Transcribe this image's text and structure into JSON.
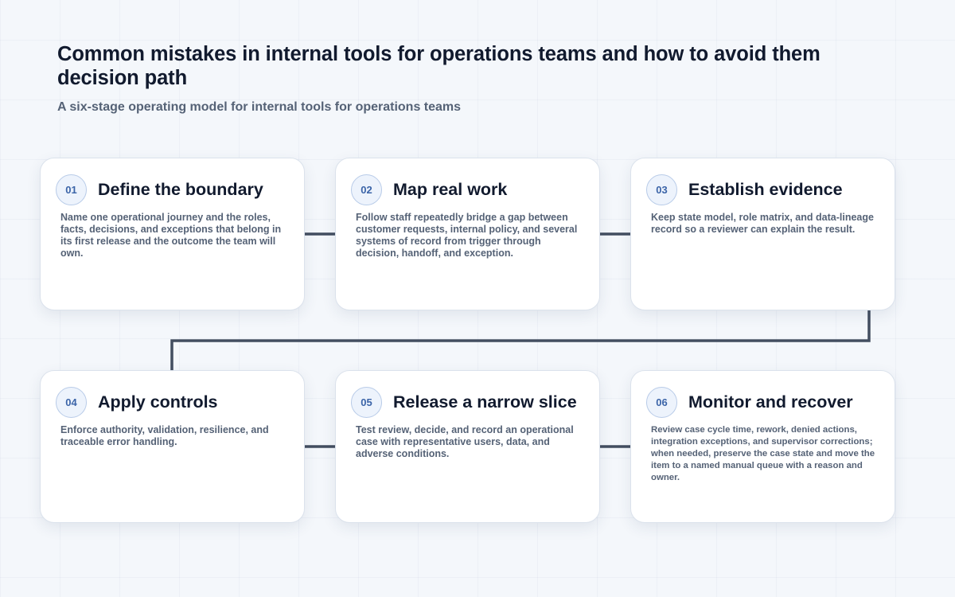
{
  "header": {
    "title": "Common mistakes in internal tools for operations teams and how to avoid them decision path",
    "subtitle": "A six-stage operating model for internal tools for operations teams"
  },
  "stages": [
    {
      "number": "01",
      "title": "Define the boundary",
      "description": "Name one operational journey and the roles, facts, decisions, and exceptions that belong in its first release and the outcome the team will own."
    },
    {
      "number": "02",
      "title": "Map real work",
      "description": "Follow staff repeatedly bridge a gap between customer requests, internal policy, and several systems of record from trigger through decision, handoff, and exception."
    },
    {
      "number": "03",
      "title": "Establish evidence",
      "description": "Keep state model, role matrix, and data-lineage record so a reviewer can explain the result."
    },
    {
      "number": "04",
      "title": "Apply controls",
      "description": "Enforce authority, validation, resilience, and traceable error handling."
    },
    {
      "number": "05",
      "title": "Release a narrow slice",
      "description": "Test review, decide, and record an operational case with representative users, data, and adverse conditions."
    },
    {
      "number": "06",
      "title": "Monitor and recover",
      "description": "Review case cycle time, rework, denied actions, integration exceptions, and supervisor corrections; when needed, preserve the case state and move the item to a named manual queue with a reason and owner."
    }
  ],
  "colors": {
    "connector": "#434e60",
    "badge_text": "#3b64a8",
    "badge_fill": "#edf3fc",
    "title_text": "#111a2e",
    "body_text": "#556276"
  }
}
